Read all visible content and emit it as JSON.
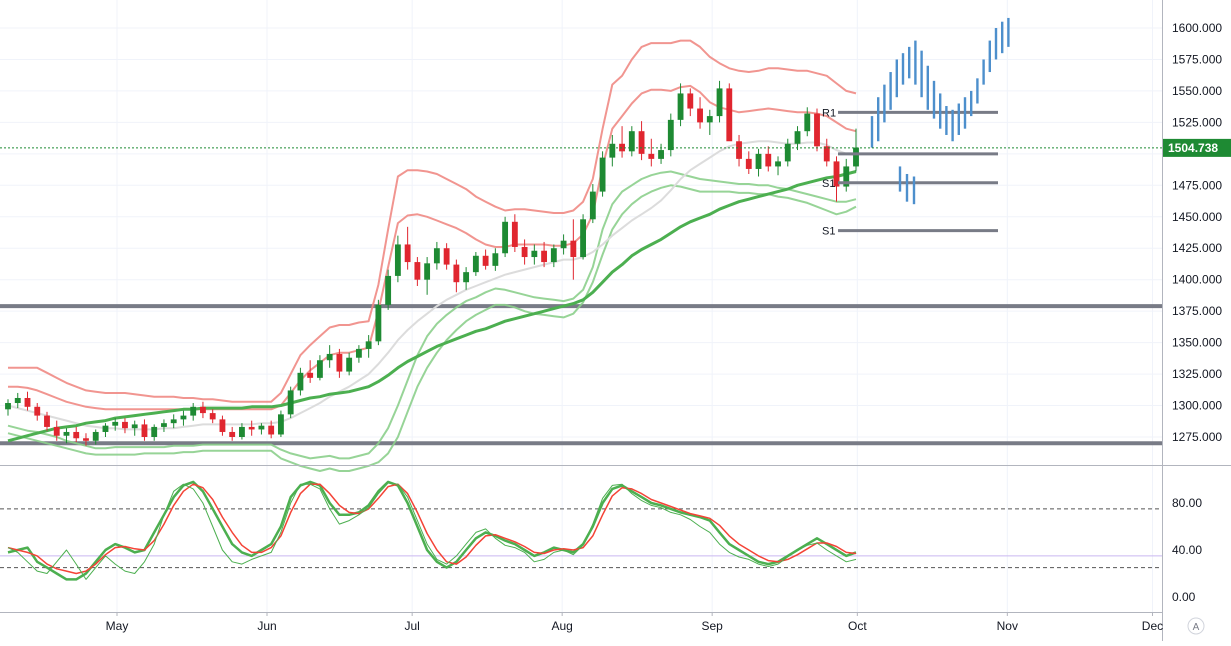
{
  "colors": {
    "up": "#1e8a33",
    "down": "#e0262f",
    "bbOuter": "#ef8a84",
    "bbInnerRed": "#ef8a84",
    "bbLowerGreen": "#8ccf8c",
    "sma": "#dcdcdc",
    "ema": "#4caf50",
    "support": "#787b86",
    "projection": "#4d8fcc",
    "stochK": "#4caf50",
    "stochD": "#f44336",
    "stochFast": "#e53935",
    "priceTag": "#1e8a33",
    "grid": "#f0f3fa",
    "axis": "#131722"
  },
  "chart_data": {
    "type": "candlestick",
    "price_axis": {
      "min": 1250,
      "max": 1625,
      "ticks": [
        "1600.000",
        "1575.000",
        "1550.000",
        "1525.000",
        "1500.000",
        "1475.000",
        "1450.000",
        "1425.000",
        "1400.000",
        "1375.000",
        "1350.000",
        "1325.000",
        "1300.000",
        "1275.000"
      ]
    },
    "current_price": {
      "value": 1504.738,
      "label": "1504.738"
    },
    "time_axis": {
      "labels": [
        {
          "text": "May",
          "date": "2020-05-01"
        },
        {
          "text": "Jun",
          "date": "2020-06-01"
        },
        {
          "text": "Jul",
          "date": "2020-07-01"
        },
        {
          "text": "Aug",
          "date": "2020-08-01"
        },
        {
          "text": "Sep",
          "date": "2020-09-01"
        },
        {
          "text": "Oct",
          "date": "2020-10-01"
        },
        {
          "text": "Nov",
          "date": "2020-11-01"
        },
        {
          "text": "Dec",
          "date": "2020-12-01"
        }
      ]
    },
    "horizontal_levels": [
      {
        "price": 1379,
        "label": ""
      },
      {
        "price": 1270,
        "label": ""
      }
    ],
    "pivot_levels": [
      {
        "label": "R1",
        "price": 1533
      },
      {
        "label": "",
        "price": 1500
      },
      {
        "label": "S1",
        "price": 1477
      },
      {
        "label": "S1",
        "price": 1439
      }
    ],
    "candles": [
      [
        1297,
        1305,
        1292,
        1302
      ],
      [
        1302,
        1310,
        1298,
        1306
      ],
      [
        1306,
        1311,
        1296,
        1299
      ],
      [
        1299,
        1302,
        1288,
        1292
      ],
      [
        1292,
        1295,
        1280,
        1283
      ],
      [
        1283,
        1288,
        1272,
        1276
      ],
      [
        1276,
        1282,
        1270,
        1279
      ],
      [
        1279,
        1283,
        1271,
        1274
      ],
      [
        1274,
        1278,
        1268,
        1272
      ],
      [
        1272,
        1281,
        1269,
        1279
      ],
      [
        1279,
        1286,
        1275,
        1284
      ],
      [
        1284,
        1290,
        1280,
        1287
      ],
      [
        1287,
        1290,
        1278,
        1282
      ],
      [
        1282,
        1288,
        1276,
        1285
      ],
      [
        1285,
        1289,
        1272,
        1275
      ],
      [
        1275,
        1285,
        1272,
        1283
      ],
      [
        1283,
        1289,
        1279,
        1286
      ],
      [
        1286,
        1293,
        1282,
        1289
      ],
      [
        1289,
        1296,
        1284,
        1292
      ],
      [
        1292,
        1302,
        1288,
        1299
      ],
      [
        1299,
        1303,
        1290,
        1294
      ],
      [
        1294,
        1297,
        1286,
        1289
      ],
      [
        1289,
        1292,
        1276,
        1279
      ],
      [
        1279,
        1283,
        1272,
        1275
      ],
      [
        1275,
        1286,
        1273,
        1283
      ],
      [
        1283,
        1288,
        1276,
        1281
      ],
      [
        1281,
        1286,
        1277,
        1284
      ],
      [
        1284,
        1288,
        1274,
        1277
      ],
      [
        1277,
        1296,
        1275,
        1293
      ],
      [
        1293,
        1315,
        1290,
        1312
      ],
      [
        1312,
        1330,
        1308,
        1326
      ],
      [
        1326,
        1336,
        1318,
        1322
      ],
      [
        1322,
        1340,
        1320,
        1336
      ],
      [
        1336,
        1348,
        1330,
        1341
      ],
      [
        1341,
        1345,
        1322,
        1327
      ],
      [
        1327,
        1342,
        1324,
        1338
      ],
      [
        1338,
        1348,
        1334,
        1345
      ],
      [
        1345,
        1356,
        1338,
        1351
      ],
      [
        1351,
        1384,
        1348,
        1380
      ],
      [
        1380,
        1408,
        1376,
        1403
      ],
      [
        1403,
        1435,
        1398,
        1428
      ],
      [
        1428,
        1442,
        1408,
        1414
      ],
      [
        1414,
        1418,
        1395,
        1400
      ],
      [
        1400,
        1418,
        1388,
        1413
      ],
      [
        1413,
        1430,
        1408,
        1425
      ],
      [
        1425,
        1429,
        1408,
        1412
      ],
      [
        1412,
        1416,
        1390,
        1398
      ],
      [
        1398,
        1410,
        1392,
        1406
      ],
      [
        1406,
        1422,
        1403,
        1419
      ],
      [
        1419,
        1424,
        1408,
        1411
      ],
      [
        1411,
        1425,
        1407,
        1421
      ],
      [
        1421,
        1450,
        1418,
        1446
      ],
      [
        1446,
        1452,
        1422,
        1426
      ],
      [
        1426,
        1432,
        1412,
        1418
      ],
      [
        1418,
        1428,
        1412,
        1423
      ],
      [
        1423,
        1430,
        1410,
        1414
      ],
      [
        1414,
        1428,
        1410,
        1425
      ],
      [
        1425,
        1436,
        1420,
        1431
      ],
      [
        1431,
        1448,
        1400,
        1418
      ],
      [
        1418,
        1452,
        1416,
        1448
      ],
      [
        1448,
        1476,
        1445,
        1470
      ],
      [
        1470,
        1502,
        1466,
        1497
      ],
      [
        1497,
        1515,
        1490,
        1508
      ],
      [
        1508,
        1522,
        1497,
        1502
      ],
      [
        1502,
        1522,
        1498,
        1518
      ],
      [
        1518,
        1526,
        1495,
        1500
      ],
      [
        1500,
        1512,
        1490,
        1496
      ],
      [
        1496,
        1508,
        1492,
        1503
      ],
      [
        1503,
        1532,
        1498,
        1527
      ],
      [
        1527,
        1556,
        1522,
        1548
      ],
      [
        1548,
        1552,
        1530,
        1536
      ],
      [
        1536,
        1545,
        1520,
        1525
      ],
      [
        1525,
        1535,
        1515,
        1530
      ],
      [
        1530,
        1558,
        1525,
        1552
      ],
      [
        1552,
        1556,
        1520,
        1510
      ],
      [
        1510,
        1515,
        1490,
        1496
      ],
      [
        1496,
        1502,
        1484,
        1488
      ],
      [
        1488,
        1504,
        1482,
        1500
      ],
      [
        1500,
        1506,
        1486,
        1490
      ],
      [
        1490,
        1498,
        1483,
        1494
      ],
      [
        1494,
        1512,
        1490,
        1508
      ],
      [
        1508,
        1522,
        1503,
        1518
      ],
      [
        1518,
        1537,
        1514,
        1532
      ],
      [
        1532,
        1536,
        1502,
        1506
      ],
      [
        1506,
        1512,
        1490,
        1494
      ],
      [
        1494,
        1498,
        1462,
        1474
      ],
      [
        1474,
        1496,
        1470,
        1490
      ],
      [
        1490,
        1520,
        1486,
        1505
      ]
    ],
    "ema_series": [
      1272,
      1274,
      1276,
      1278,
      1280,
      1282,
      1283,
      1284,
      1286,
      1287,
      1288,
      1290,
      1291,
      1292,
      1293,
      1294,
      1295,
      1296,
      1297,
      1297,
      1298,
      1298,
      1298,
      1298,
      1298,
      1299,
      1299,
      1299,
      1300,
      1302,
      1304,
      1306,
      1307,
      1309,
      1310,
      1311,
      1313,
      1315,
      1319,
      1324,
      1330,
      1335,
      1339,
      1343,
      1347,
      1350,
      1353,
      1356,
      1359,
      1361,
      1364,
      1367,
      1369,
      1371,
      1373,
      1375,
      1377,
      1379,
      1381,
      1384,
      1390,
      1398,
      1406,
      1412,
      1419,
      1424,
      1428,
      1432,
      1437,
      1442,
      1446,
      1449,
      1452,
      1456,
      1459,
      1462,
      1464,
      1466,
      1468,
      1470,
      1472,
      1475,
      1477,
      1479,
      1481,
      1482,
      1484,
      1486
    ],
    "sma_series": [
      1300,
      1298,
      1296,
      1294,
      1292,
      1290,
      1288,
      1286,
      1284,
      1283,
      1282,
      1282,
      1281,
      1281,
      1281,
      1281,
      1282,
      1282,
      1283,
      1284,
      1285,
      1285,
      1285,
      1285,
      1285,
      1285,
      1286,
      1286,
      1287,
      1290,
      1294,
      1298,
      1302,
      1307,
      1311,
      1315,
      1320,
      1325,
      1333,
      1342,
      1352,
      1360,
      1367,
      1373,
      1379,
      1384,
      1388,
      1392,
      1395,
      1398,
      1401,
      1404,
      1406,
      1408,
      1410,
      1412,
      1414,
      1416,
      1416,
      1418,
      1422,
      1428,
      1435,
      1441,
      1447,
      1452,
      1457,
      1463,
      1471,
      1480,
      1487,
      1492,
      1497,
      1502,
      1506,
      1508,
      1509,
      1510,
      1510,
      1509,
      1508,
      1508,
      1509,
      1509,
      1507,
      1503,
      1500,
      1499
    ],
    "bb_upper_series": [
      1330,
      1330,
      1330,
      1330,
      1326,
      1322,
      1318,
      1315,
      1312,
      1311,
      1310,
      1310,
      1310,
      1309,
      1308,
      1307,
      1307,
      1307,
      1306,
      1306,
      1305,
      1305,
      1304,
      1303,
      1303,
      1303,
      1303,
      1303,
      1310,
      1325,
      1340,
      1348,
      1355,
      1362,
      1364,
      1364,
      1366,
      1367,
      1396,
      1440,
      1482,
      1487,
      1487,
      1486,
      1484,
      1480,
      1476,
      1472,
      1466,
      1462,
      1458,
      1455,
      1456,
      1456,
      1455,
      1454,
      1453,
      1453,
      1455,
      1462,
      1480,
      1520,
      1555,
      1562,
      1575,
      1585,
      1588,
      1588,
      1588,
      1590,
      1590,
      1585,
      1577,
      1572,
      1568,
      1566,
      1565,
      1566,
      1568,
      1568,
      1567,
      1566,
      1566,
      1564,
      1562,
      1556,
      1550,
      1548
    ],
    "bb_middle_upper_series": [
      1315,
      1315,
      1314,
      1312,
      1309,
      1306,
      1303,
      1301,
      1299,
      1298,
      1297,
      1297,
      1297,
      1297,
      1297,
      1297,
      1297,
      1297,
      1297,
      1297,
      1297,
      1297,
      1297,
      1297,
      1297,
      1297,
      1297,
      1297,
      1300,
      1310,
      1320,
      1328,
      1334,
      1340,
      1342,
      1342,
      1344,
      1346,
      1375,
      1410,
      1445,
      1451,
      1452,
      1450,
      1447,
      1444,
      1441,
      1437,
      1432,
      1428,
      1426,
      1426,
      1428,
      1428,
      1428,
      1428,
      1427,
      1427,
      1429,
      1436,
      1452,
      1490,
      1520,
      1530,
      1540,
      1548,
      1551,
      1551,
      1550,
      1553,
      1554,
      1549,
      1541,
      1537,
      1535,
      1533,
      1534,
      1535,
      1536,
      1535,
      1534,
      1533,
      1533,
      1532,
      1530,
      1525,
      1520,
      1518
    ],
    "bb_lower_series": [
      1284,
      1282,
      1280,
      1279,
      1277,
      1275,
      1272,
      1270,
      1268,
      1266,
      1266,
      1267,
      1267,
      1267,
      1267,
      1267,
      1267,
      1268,
      1268,
      1268,
      1269,
      1269,
      1269,
      1269,
      1269,
      1269,
      1269,
      1269,
      1265,
      1262,
      1260,
      1258,
      1259,
      1260,
      1258,
      1258,
      1260,
      1262,
      1270,
      1282,
      1300,
      1320,
      1340,
      1355,
      1365,
      1372,
      1378,
      1383,
      1386,
      1390,
      1393,
      1392,
      1390,
      1388,
      1386,
      1385,
      1384,
      1383,
      1385,
      1392,
      1410,
      1440,
      1460,
      1470,
      1475,
      1480,
      1483,
      1485,
      1486,
      1484,
      1482,
      1480,
      1479,
      1478,
      1477,
      1476,
      1476,
      1475,
      1475,
      1473,
      1472,
      1470,
      1468,
      1466,
      1464,
      1462,
      1462,
      1464
    ],
    "bb_lower2_series": [
      1278,
      1276,
      1274,
      1272,
      1270,
      1268,
      1266,
      1264,
      1262,
      1261,
      1261,
      1261,
      1261,
      1261,
      1262,
      1262,
      1262,
      1262,
      1263,
      1263,
      1264,
      1264,
      1264,
      1264,
      1264,
      1264,
      1264,
      1264,
      1258,
      1255,
      1252,
      1250,
      1248,
      1250,
      1248,
      1248,
      1250,
      1252,
      1255,
      1262,
      1275,
      1295,
      1315,
      1330,
      1342,
      1352,
      1360,
      1367,
      1372,
      1376,
      1380,
      1380,
      1378,
      1375,
      1373,
      1372,
      1371,
      1370,
      1373,
      1382,
      1398,
      1420,
      1440,
      1452,
      1460,
      1466,
      1470,
      1473,
      1475,
      1474,
      1472,
      1470,
      1470,
      1470,
      1470,
      1469,
      1469,
      1468,
      1468,
      1466,
      1465,
      1463,
      1461,
      1458,
      1455,
      1452,
      1454,
      1458
    ],
    "projection_bars": [
      [
        1505,
        1530
      ],
      [
        1510,
        1545
      ],
      [
        1525,
        1555
      ],
      [
        1535,
        1565
      ],
      [
        1545,
        1575
      ],
      [
        1555,
        1580
      ],
      [
        1560,
        1585
      ],
      [
        1555,
        1590
      ],
      [
        1545,
        1582
      ],
      [
        1535,
        1570
      ],
      [
        1528,
        1558
      ],
      [
        1520,
        1548
      ],
      [
        1515,
        1538
      ],
      [
        1510,
        1535
      ],
      [
        1515,
        1540
      ],
      [
        1520,
        1545
      ],
      [
        1530,
        1550
      ],
      [
        1540,
        1560
      ],
      [
        1555,
        1575
      ],
      [
        1565,
        1590
      ],
      [
        1575,
        1600
      ],
      [
        1580,
        1605
      ],
      [
        1585,
        1608
      ]
    ],
    "projection_low_bars": [
      [
        1470,
        1490
      ],
      [
        1462,
        1484
      ],
      [
        1460,
        1482
      ]
    ],
    "stochastic": {
      "ticks": [
        "80.00",
        "40.00",
        "0.00"
      ],
      "min": 0,
      "max": 100,
      "upper_dashed": 75,
      "lower_dashed": 25,
      "mid_line": 35
    },
    "stoch_k": [
      38,
      40,
      42,
      30,
      25,
      20,
      15,
      15,
      20,
      30,
      40,
      45,
      42,
      38,
      40,
      55,
      70,
      85,
      95,
      98,
      90,
      75,
      60,
      45,
      38,
      35,
      40,
      45,
      60,
      85,
      95,
      98,
      95,
      80,
      70,
      70,
      72,
      78,
      90,
      98,
      95,
      80,
      60,
      40,
      30,
      25,
      30,
      40,
      50,
      55,
      52,
      48,
      45,
      40,
      35,
      38,
      42,
      40,
      38,
      45,
      60,
      80,
      92,
      95,
      90,
      85,
      80,
      78,
      75,
      72,
      70,
      68,
      65,
      55,
      45,
      40,
      35,
      30,
      28,
      30,
      35,
      40,
      45,
      50,
      45,
      40,
      35,
      38
    ],
    "stoch_d": [
      42,
      40,
      38,
      35,
      28,
      24,
      22,
      20,
      22,
      28,
      36,
      42,
      43,
      41,
      40,
      48,
      62,
      78,
      90,
      96,
      93,
      83,
      68,
      55,
      44,
      38,
      38,
      42,
      52,
      72,
      88,
      96,
      96,
      88,
      78,
      72,
      71,
      75,
      84,
      94,
      96,
      88,
      72,
      54,
      40,
      30,
      28,
      34,
      44,
      52,
      53,
      50,
      47,
      43,
      38,
      37,
      40,
      41,
      40,
      42,
      52,
      70,
      86,
      93,
      92,
      88,
      83,
      80,
      77,
      74,
      71,
      69,
      67,
      61,
      52,
      45,
      40,
      35,
      31,
      30,
      32,
      36,
      41,
      46,
      46,
      43,
      38,
      37
    ],
    "stoch_fast": [
      42,
      38,
      30,
      22,
      20,
      30,
      40,
      28,
      15,
      25,
      35,
      28,
      22,
      20,
      30,
      45,
      70,
      90,
      96,
      92,
      80,
      60,
      40,
      30,
      28,
      32,
      35,
      38,
      55,
      80,
      96,
      96,
      92,
      75,
      62,
      65,
      70,
      76,
      88,
      97,
      96,
      85,
      65,
      45,
      32,
      28,
      35,
      45,
      55,
      58,
      50,
      44,
      42,
      38,
      30,
      32,
      38,
      40,
      36,
      44,
      62,
      84,
      95,
      96,
      88,
      82,
      78,
      76,
      72,
      70,
      66,
      60,
      55,
      45,
      38,
      34,
      32,
      28,
      26,
      28,
      34,
      40,
      44,
      46,
      40,
      35,
      30,
      32
    ]
  }
}
